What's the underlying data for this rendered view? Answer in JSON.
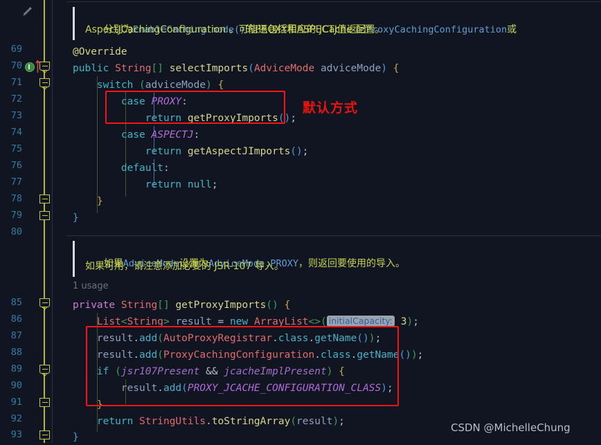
{
  "editor": {
    "background_color": "#111522",
    "gutter_icon_pencil": "pencil-icon",
    "line_numbers": [
      "69",
      "70",
      "71",
      "72",
      "73",
      "74",
      "75",
      "76",
      "77",
      "78",
      "79",
      "80",
      "85",
      "86",
      "87",
      "88",
      "89",
      "90",
      "91",
      "92",
      "93"
    ]
  },
  "doc_top": {
    "line1_pre": "分别为",
    "line1_link1": "EnableCaching.mode()",
    "line1_mid": "的PROXY和ASPECTJ值返回",
    "line1_link2": "ProxyCachingConfiguration",
    "line1_post": "或",
    "line2": "AspectJCachingConfiguration 。可能还包括相应的 JCache 配置。"
  },
  "doc_bottom": {
    "line1_pre": "如果",
    "line1_link1": "AdviceMode",
    "line1_mid": "设置为",
    "line1_link2": "AdviceMode.PROXY",
    "line1_post": "，则返回要使用的导入。",
    "line2": "如果可用，请注意添加必要的 JSR-107 导入。"
  },
  "usage_hint": "1 usage",
  "inlay_hint": "initialCapacity:",
  "annotations": {
    "label_default_mode": "默认方式",
    "box_color": "#f21616"
  },
  "watermark": "CSDN @MichelleChung",
  "code_lines": [
    {
      "num": "69",
      "text": "@Override"
    },
    {
      "num": "70",
      "text": "public String[] selectImports(AdviceMode adviceMode) {"
    },
    {
      "num": "71",
      "text": "    switch (adviceMode) {"
    },
    {
      "num": "72",
      "text": "        case PROXY:"
    },
    {
      "num": "73",
      "text": "            return getProxyImports();"
    },
    {
      "num": "74",
      "text": "        case ASPECTJ:"
    },
    {
      "num": "75",
      "text": "            return getAspectJImports();"
    },
    {
      "num": "76",
      "text": "        default:"
    },
    {
      "num": "77",
      "text": "            return null;"
    },
    {
      "num": "78",
      "text": "    }"
    },
    {
      "num": "79",
      "text": "}"
    },
    {
      "num": "80",
      "text": ""
    },
    {
      "num": "85",
      "text": "private String[] getProxyImports() {"
    },
    {
      "num": "86",
      "text": "    List<String> result = new ArrayList<>(initialCapacity: 3);"
    },
    {
      "num": "87",
      "text": "    result.add(AutoProxyRegistrar.class.getName());"
    },
    {
      "num": "88",
      "text": "    result.add(ProxyCachingConfiguration.class.getName());"
    },
    {
      "num": "89",
      "text": "    if (jsr107Present && jcacheImplPresent) {"
    },
    {
      "num": "90",
      "text": "        result.add(PROXY_JCACHE_CONFIGURATION_CLASS);"
    },
    {
      "num": "91",
      "text": "    }"
    },
    {
      "num": "92",
      "text": "    return StringUtils.toStringArray(result);"
    },
    {
      "num": "93",
      "text": "}"
    }
  ],
  "gutter_markers": {
    "override_marker": "implemented-method-icon",
    "fold_rows": [
      "70",
      "71",
      "78",
      "79",
      "85",
      "89",
      "91",
      "93"
    ]
  },
  "colors": {
    "keyword_purple": "#cb7dd4",
    "keyword_cyan": "#3fb5c4",
    "type_salmon": "#e06c6c",
    "constant_purple": "#b06bd8",
    "method_blue": "#45b0c7",
    "doc_yellow": "#c5d24d",
    "doc_link_blue": "#5f9fd4",
    "linenumber_blue": "#2e7da6",
    "fold_yellow": "#c7c73e",
    "annotation_red": "#f21616"
  }
}
